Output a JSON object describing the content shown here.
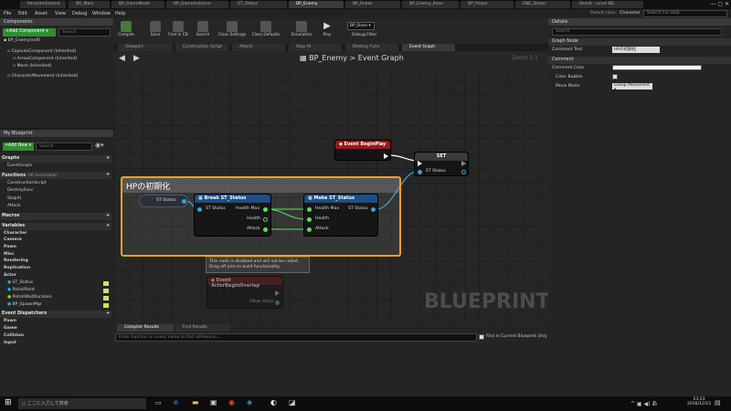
{
  "tabs": [
    "ParasiterExtend",
    "BG_Main",
    "BP_GameMode",
    "BP_GameInstance",
    "ST_Status",
    "BP_Enemy",
    "BP_Robot",
    "BP_Enemy_Base",
    "BP_Player",
    "ENE_Status",
    "Result - Level BG"
  ],
  "window": {
    "parent_class_label": "Parent class:",
    "parent_class": "Character",
    "search_help": "Search For Help"
  },
  "menu": [
    "File",
    "Edit",
    "Asset",
    "View",
    "Debug",
    "Window",
    "Help"
  ],
  "components": {
    "title": "Components",
    "add_btn": "+Add Component ▾",
    "search_ph": "Search",
    "items": [
      "BP_Enemy(self)",
      "CapsuleComponent (Inherited)",
      "ArrowComponent (Inherited)",
      "Mesh (Inherited)",
      "CharacterMovement (Inherited)"
    ]
  },
  "toolbar": {
    "buttons": [
      "Compile",
      "Save",
      "Find in CB",
      "Search",
      "Class Settings",
      "Class Defaults",
      "Simulation",
      "Play"
    ],
    "debug_sel": "BP_Base ▾",
    "debug_filter": "Debug Filter"
  },
  "graph_tabs": [
    "Viewport",
    "Construction Script",
    "Attack",
    "Stop AI",
    "Destroy Func",
    "Event Graph"
  ],
  "breadcrumb": {
    "bp": "BP_Enemy",
    "sep": ">",
    "graph": "Event Graph"
  },
  "zoom": "Zoom 1:1",
  "myblueprint": {
    "title": "My Blueprint",
    "add_new": "+Add New ▾",
    "search_ph": "Search",
    "graphs_label": "Graphs",
    "graphs": [
      "EventGraph"
    ],
    "functions_label": "Functions",
    "functions_count": "(36 Overridable)",
    "functions": [
      "ConstructionScript",
      "DestroyFunc",
      "StopAI",
      "Attack"
    ],
    "macros_label": "Macros",
    "variables_label": "Variables",
    "var_categories": [
      "Character",
      "Camera",
      "Pawn",
      "Misc",
      "Rendering",
      "Replication"
    ],
    "actor_label": "Actor",
    "actor_vars": [
      "ST_Status",
      "PatrolPoint",
      "PatrolWaitDuration",
      "BP_SpawnMgr"
    ],
    "dispatchers_label": "Event Dispatchers",
    "dispatchers": [
      "Pawn",
      "Game",
      "Collision",
      "Input"
    ]
  },
  "graph": {
    "comment": "HPの初期化",
    "event_beginplay": "Event BeginPlay",
    "set": "SET",
    "set_pin": "ST Status",
    "st_status_var": "ST Status",
    "break_node": "Break ST_Status",
    "break_in": "ST Status",
    "break_out": [
      "Health Max",
      "Health",
      "Attack"
    ],
    "make_node": "Make ST_Status",
    "make_in": [
      "Health Max",
      "Health",
      "Attack"
    ],
    "make_out": "ST Status",
    "tooltip": "This node is disabled and will not be called. Drag off pins to build functionality.",
    "overlap_node": "Event ActorBeginOverlap",
    "overlap_pin": "Other Actor",
    "watermark": "BLUEPRINT"
  },
  "bottom": {
    "tabs": [
      "Compiler Results",
      "Find Results"
    ],
    "search_ph": "Enter function or event name to find references...",
    "find_current": "Find in Current Blueprint Only"
  },
  "details": {
    "title": "Details",
    "search_ph": "Search",
    "graph_node_label": "Graph Node",
    "comment_text_label": "Comment Text",
    "comment_text_value": "HPの初期化",
    "comment_label": "Comment",
    "comment_color_label": "Comment Color",
    "color_bubble_label": "Color Bubble",
    "move_mode_label": "Move Mode",
    "move_mode_value": "Group Movement ▾"
  },
  "taskbar": {
    "search_ph": "ここに入力して検索",
    "time": "23:23",
    "date": "2016/12/23"
  },
  "colors": {
    "accent": "#f0a030",
    "event": "#9a1a1a",
    "struct": "#1f4d86",
    "exec": "#ffffff",
    "bool": "#5ae05a",
    "struct_pin": "#39a3d6"
  }
}
